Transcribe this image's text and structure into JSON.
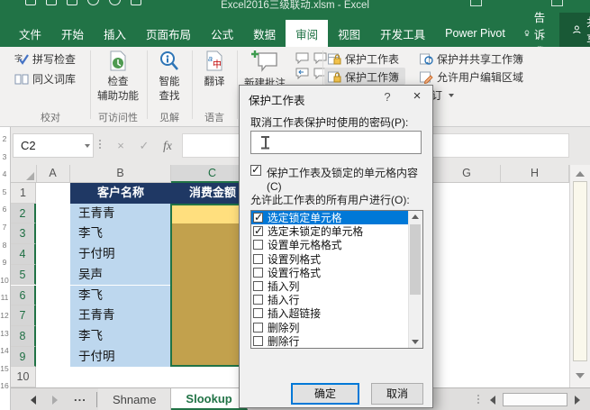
{
  "titlebar": {
    "title": "Excel2016三级联动.xlsm - Excel"
  },
  "ribbon": {
    "tabs": [
      {
        "label": "文件"
      },
      {
        "label": "开始"
      },
      {
        "label": "插入"
      },
      {
        "label": "页面布局"
      },
      {
        "label": "公式"
      },
      {
        "label": "数据"
      },
      {
        "label": "审阅",
        "active": true
      },
      {
        "label": "视图"
      },
      {
        "label": "开发工具"
      },
      {
        "label": "Power Pivot"
      }
    ],
    "tellme": "告诉我",
    "share": "共享",
    "groups": {
      "proofing": {
        "label": "校对",
        "spelling": "拼写检查",
        "thesaurus": "同义词库"
      },
      "accessibility": {
        "label": "可访问性",
        "button_line1": "检查",
        "button_line2": "辅助功能"
      },
      "insights": {
        "label": "见解",
        "button_line1": "智能",
        "button_line2": "查找"
      },
      "language": {
        "label": "语言",
        "button": "翻译"
      },
      "comments": {
        "new_comment": "新建批注"
      },
      "protect": {
        "protect_sheet": "保护工作表",
        "protect_workbook": "保护工作簿",
        "protect_and_share": "保护并共享工作簿",
        "allow_edit_ranges": "允许用户编辑区域",
        "track_changes": "修订"
      }
    }
  },
  "formula_bar": {
    "name_box": "C2",
    "fx_label": "fx"
  },
  "background_window_row_numbers": [
    2,
    3,
    4,
    5,
    6,
    7,
    8,
    9,
    10,
    11,
    12,
    13,
    14,
    15,
    16
  ],
  "grid": {
    "visible_columns": [
      "A",
      "B",
      "C",
      "G",
      "H"
    ],
    "selected_column": "C",
    "row_numbers": [
      1,
      2,
      3,
      4,
      5,
      6,
      7,
      8,
      9,
      10
    ],
    "selected_rows": [
      2,
      3,
      4,
      5,
      6,
      7,
      8,
      9
    ],
    "table": {
      "headers": [
        "客户名称",
        "消费金额"
      ],
      "customer_names": [
        "王青青",
        "李飞",
        "于付明",
        "吴声",
        "李飞",
        "王青青",
        "李飞",
        "于付明"
      ]
    }
  },
  "sheet_tabs": {
    "overflow": "...",
    "tabs": [
      {
        "label": "Shname"
      },
      {
        "label": "Slookup",
        "active": true
      }
    ]
  },
  "dialog": {
    "title": "保护工作表",
    "help": "?",
    "close": "×",
    "password_label": "取消工作表保护时使用的密码(P):",
    "password_value": "",
    "protect_checkbox_label": "保护工作表及锁定的单元格内容(C)",
    "protect_checkbox_checked": true,
    "allow_label": "允许此工作表的所有用户进行(O):",
    "options": [
      {
        "label": "选定锁定单元格",
        "checked": true,
        "selected": true
      },
      {
        "label": "选定未锁定的单元格",
        "checked": true
      },
      {
        "label": "设置单元格格式",
        "checked": false
      },
      {
        "label": "设置列格式",
        "checked": false
      },
      {
        "label": "设置行格式",
        "checked": false
      },
      {
        "label": "插入列",
        "checked": false
      },
      {
        "label": "插入行",
        "checked": false
      },
      {
        "label": "插入超链接",
        "checked": false
      },
      {
        "label": "删除列",
        "checked": false
      },
      {
        "label": "删除行",
        "checked": false
      }
    ],
    "ok": "确定",
    "cancel": "取消"
  },
  "colors": {
    "excel_green": "#217346",
    "table_header_navy": "#1F3864",
    "cell_blue": "#BDD7EE",
    "cell_yellow_active": "#FFDF7E",
    "cell_yellow_shaded": "#C2A14D",
    "selection_green": "#217346",
    "list_highlight_blue": "#0078D7",
    "default_button_border": "#0078D7"
  }
}
